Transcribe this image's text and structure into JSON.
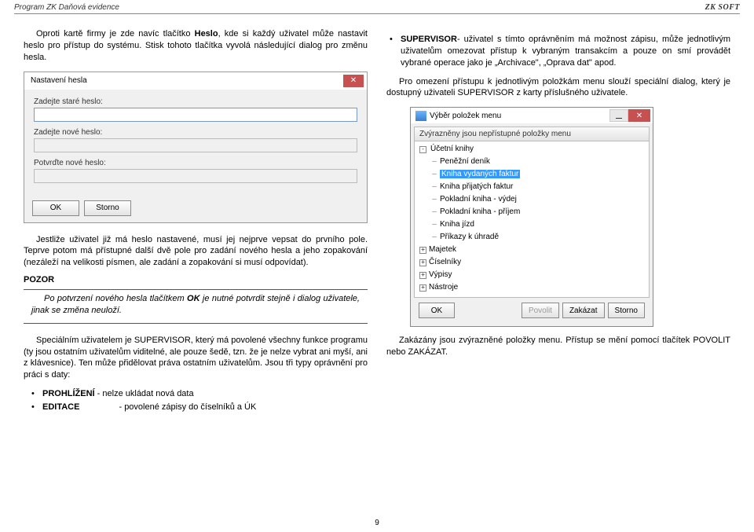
{
  "header": {
    "left": "Program ZK Daňová evidence",
    "right": "ZK SOFT"
  },
  "left_col": {
    "p1_a": "Oproti kartě firmy je zde navíc tlačítko ",
    "p1_b": "Heslo",
    "p1_c": ", kde si každý uživatel může nastavit heslo pro přístup do systému. Stisk tohoto tlačítka vyvolá následující dialog pro změnu hesla.",
    "p2": "Jestliže uživatel již má heslo nastavené, musí jej nejprve vepsat do prvního pole. Teprve potom má přístupné další dvě pole pro zadání nového hesla a jeho zopakování (nezáleží na velikosti písmen, ale zadání a zopakování si musí odpovídat).",
    "pozor": "POZOR",
    "p3_a": "Po potvrzení nového hesla tlačítkem ",
    "p3_b": "OK",
    "p3_c": " je nutné potvrdit stejně i dialog uživatele, jinak se změna neuloží.",
    "p4": "Speciálním uživatelem je SUPERVISOR, který má povolené všechny funkce programu (ty jsou ostatním uživatelům viditelné, ale pouze šedě, tzn. že je nelze vybrat ani myší, ani z klávesnice). Ten může přidělovat práva ostatním uživatelům. Jsou tři typy oprávnění pro práci s daty:",
    "bul1_a": "PROHLÍŽENÍ",
    "bul1_b": " - nelze ukládat  nová data",
    "bul2_a": "EDITACE",
    "bul2_b": "- povolené zápisy do číselníků a ÚK"
  },
  "dialog1": {
    "title": "Nastavení hesla",
    "lbl_old": "Zadejte staré heslo:",
    "lbl_new": "Zadejte nové heslo:",
    "lbl_conf": "Potvrďte nové heslo:",
    "ok": "OK",
    "cancel": "Storno"
  },
  "right_col": {
    "b1_a": "SUPERVISOR",
    "b1_b": "- uživatel s tímto oprávněním má možnost zápisu, může jednotlivým uživatelům omezovat přístup k vybraným transakcím a pouze on smí provádět vybrané operace jako je „Archivace\", „Oprava dat\"  apod.",
    "p2": "Pro omezení přístupu k jednotlivým položkám menu slouží speciální dialog, který je dostupný uživateli SUPERVISOR z karty příslušného uživatele.",
    "p3": "Zakázány jsou zvýrazněné položky menu. Přístup se mění pomocí tlačítek POVOLIT nebo ZAKÁZAT."
  },
  "dialog2": {
    "title": "Výběr položek menu",
    "header": "Zvýrazněny jsou nepřístupné položky menu",
    "tree": {
      "n1": "Účetní knihy",
      "n1_1": "Peněžní deník",
      "n1_2": "Kniha vydaných faktur",
      "n1_3": "Kniha přijatých faktur",
      "n1_4": "Pokladní kniha - výdej",
      "n1_5": "Pokladní kniha - příjem",
      "n1_6": "Kniha jízd",
      "n1_7": "Příkazy k úhradě",
      "n2": "Majetek",
      "n3": "Číselníky",
      "n4": "Výpisy",
      "n5": "Nástroje"
    },
    "btn_ok": "OK",
    "btn_allow": "Povolit",
    "btn_deny": "Zakázat",
    "btn_cancel": "Storno"
  },
  "page_number": "9"
}
